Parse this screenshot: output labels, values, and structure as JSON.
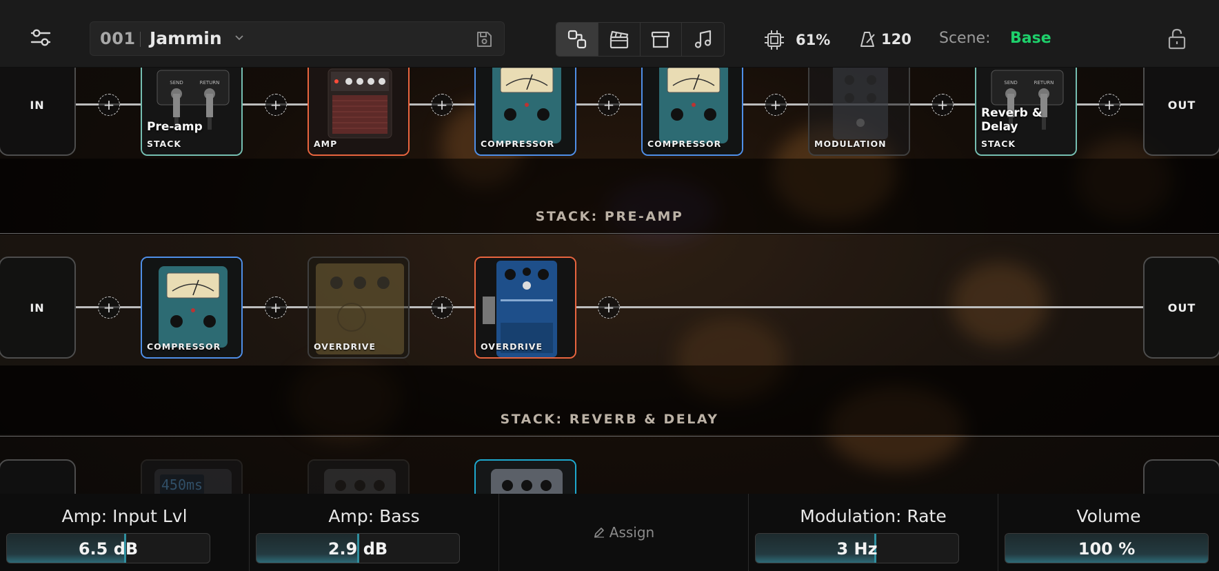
{
  "topbar": {
    "preset_number": "001",
    "preset_name": "Jammin",
    "cpu_value": "61%",
    "tempo_value": "120",
    "scene_label": "Scene:",
    "scene_value": "Base",
    "icons": [
      "settings-sliders-icon",
      "chevron-down-icon",
      "save-icon",
      "signal-chain-icon",
      "scenes-clapper-icon",
      "archive-icon",
      "music-note-icon",
      "cpu-icon",
      "metronome-icon",
      "lock-open-icon"
    ]
  },
  "colors": {
    "scene_accent": "#1ed06b",
    "stack_border": "#76bfb2",
    "amp_border": "#e9653f",
    "compressor_border": "#4f8fe8",
    "delay_border": "#1ea9cf"
  },
  "main_chain": {
    "in_label": "IN",
    "out_label": "OUT",
    "blocks": [
      {
        "title": "Pre-amp",
        "label": "STACK"
      },
      {
        "title": "",
        "label": "AMP"
      },
      {
        "title": "",
        "label": "COMPRESSOR"
      },
      {
        "title": "",
        "label": "COMPRESSOR"
      },
      {
        "title": "",
        "label": "MODULATION"
      },
      {
        "title": "Reverb & Delay",
        "label": "STACK"
      }
    ]
  },
  "stack_preamp": {
    "heading": "STACK: PRE-AMP",
    "in_label": "IN",
    "out_label": "OUT",
    "blocks": [
      {
        "label": "COMPRESSOR"
      },
      {
        "label": "OVERDRIVE"
      },
      {
        "label": "OVERDRIVE"
      }
    ]
  },
  "stack_reverb": {
    "heading": "STACK: REVERB & DELAY",
    "delay_display": "450ms"
  },
  "bottom": {
    "params": [
      {
        "title": "Amp: Input Lvl",
        "value": "6.5 dB",
        "level": 0.58
      },
      {
        "title": "Amp: Bass",
        "value": "2.9 dB",
        "level": 0.5
      },
      {
        "title": "Modulation: Rate",
        "value": "3 Hz",
        "level": 0.59
      },
      {
        "title": "Volume",
        "value": "100 %",
        "level": 1.0
      }
    ],
    "assign_label": "Assign"
  }
}
